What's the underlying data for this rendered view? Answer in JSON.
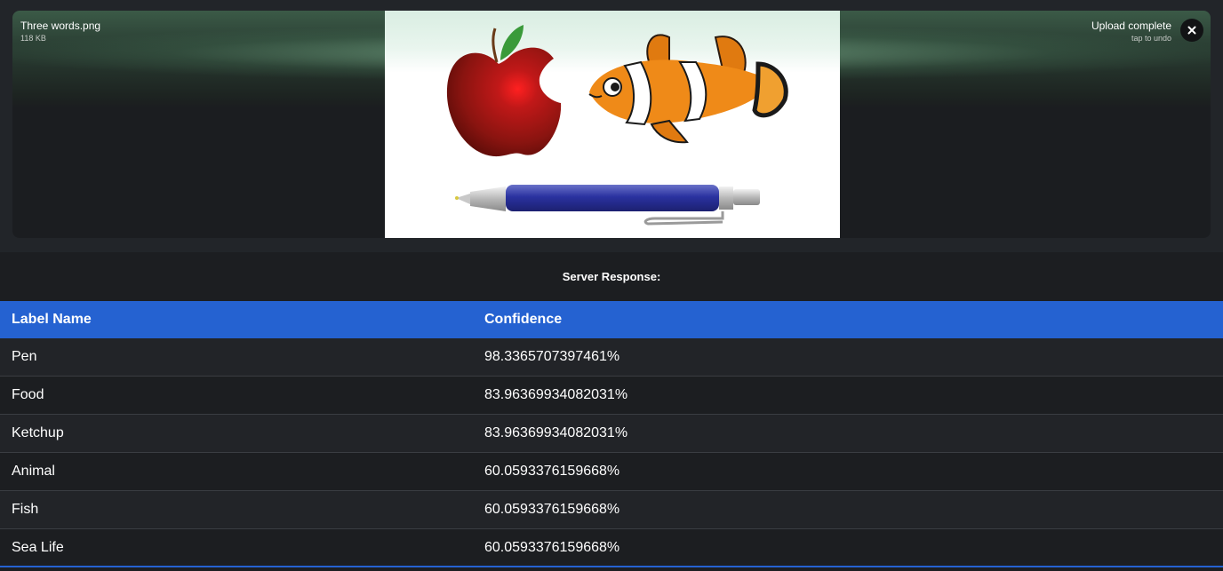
{
  "upload": {
    "file_name": "Three words.png",
    "file_size": "118 KB",
    "status": "Upload complete",
    "status_sub": "tap to undo",
    "close_icon": "close-icon"
  },
  "server_response_label": "Server Response:",
  "table": {
    "headers": [
      "Label Name",
      "Confidence"
    ],
    "rows": [
      {
        "label": "Pen",
        "confidence": "98.3365707397461%"
      },
      {
        "label": "Food",
        "confidence": "83.96369934082031%"
      },
      {
        "label": "Ketchup",
        "confidence": "83.96369934082031%"
      },
      {
        "label": "Animal",
        "confidence": "60.0593376159668%"
      },
      {
        "label": "Fish",
        "confidence": "60.0593376159668%"
      },
      {
        "label": "Sea Life",
        "confidence": "60.0593376159668%"
      }
    ]
  },
  "colors": {
    "accent": "#2562d1",
    "background": "#1c1e21"
  }
}
